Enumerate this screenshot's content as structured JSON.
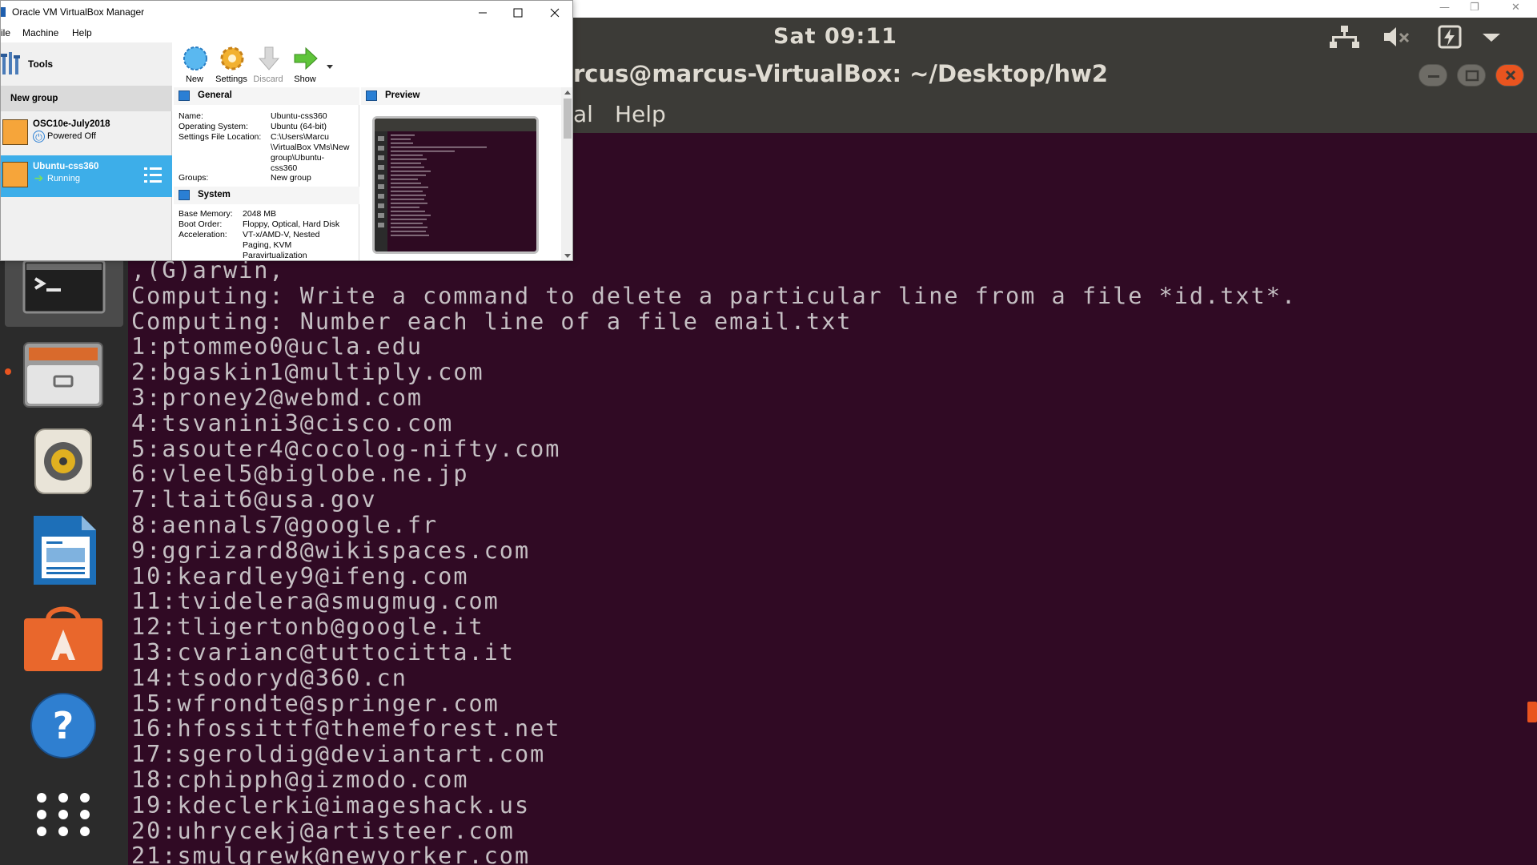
{
  "host": {
    "restore_glyph": "❐",
    "close_glyph": "✕",
    "minimize_glyph": "—"
  },
  "ubuntu_panel": {
    "clock": "Sat 09:11",
    "tray_icons": [
      "network-icon",
      "volume-muted-icon",
      "power-icon",
      "menu-down-icon"
    ]
  },
  "terminal": {
    "title": "rcus@marcus-VirtualBox: ~/Desktop/hw2",
    "menus": [
      "al",
      "Help"
    ],
    "lines": [
      ",(G)arwin,",
      "Computing: Write a command to delete a particular line from a file *id.txt*.",
      "Computing: Number each line of a file email.txt",
      "1:ptommeo0@ucla.edu",
      "2:bgaskin1@multiply.com",
      "3:proney2@webmd.com",
      "4:tsvanini3@cisco.com",
      "5:asouter4@cocolog-nifty.com",
      "6:vleel5@biglobe.ne.jp",
      "7:ltait6@usa.gov",
      "8:aennals7@google.fr",
      "9:ggrizard8@wikispaces.com",
      "10:keardley9@ifeng.com",
      "11:tvidelera@smugmug.com",
      "12:tligertonb@google.it",
      "13:cvarianc@tuttocitta.it",
      "14:tsodoryd@360.cn",
      "15:wfrondte@springer.com",
      "16:hfossittf@themeforest.net",
      "17:sgeroldig@deviantart.com",
      "18:cphipph@gizmodo.com",
      "19:kdeclerki@imageshack.us",
      "20:uhrycekj@artisteer.com",
      "21:smulgrewk@newyorker.com"
    ]
  },
  "launcher": {
    "items": [
      "terminal-icon",
      "files-icon",
      "rhythmbox-icon",
      "writer-icon",
      "software-center-icon",
      "help-icon",
      "app-grid-icon"
    ],
    "help_glyph": "?"
  },
  "vbox": {
    "title": "Oracle VM VirtualBox Manager",
    "menus": [
      "ile",
      "Machine",
      "Help"
    ],
    "tools_label": "Tools",
    "group_label": "New group",
    "vms": [
      {
        "name": "OSC10e-July2018",
        "state": "Powered Off"
      },
      {
        "name": "Ubuntu-css360",
        "state": "Running"
      }
    ],
    "toolbar": {
      "new": "New",
      "settings": "Settings",
      "discard": "Discard",
      "show": "Show"
    },
    "general": {
      "title": "General",
      "name_key": "Name:",
      "name_val": "Ubuntu-css360",
      "os_key": "Operating System:",
      "os_val": "Ubuntu (64-bit)",
      "loc_key": "Settings File Location:",
      "loc_val": "C:\\Users\\Marcu\n\\VirtualBox VMs\\New\ngroup\\Ubuntu-\ncss360",
      "groups_key": "Groups:",
      "groups_val": "New group"
    },
    "system": {
      "title": "System",
      "mem_key": "Base Memory:",
      "mem_val": "2048 MB",
      "boot_key": "Boot Order:",
      "boot_val": "Floppy, Optical, Hard Disk",
      "accel_key": "Acceleration:",
      "accel_val": "VT-x/AMD-V, Nested\nPaging, KVM\nParavirtualization"
    },
    "preview_title": "Preview"
  },
  "colors": {
    "terminal_bg": "#300a24",
    "panel_bg": "#3c3b37",
    "launcher_bg": "#2b2b2b",
    "accent": "#e9541f",
    "selection": "#3daee9"
  }
}
